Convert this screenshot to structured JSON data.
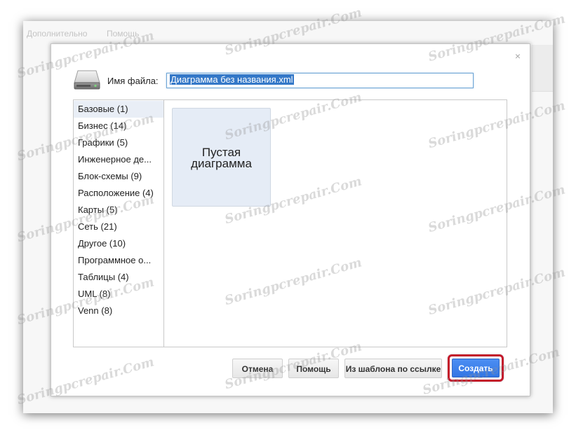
{
  "app": {
    "menu": [
      "Дополнительно",
      "Помощь"
    ]
  },
  "dialog": {
    "close_glyph": "×",
    "filename_label": "Имя файла:",
    "filename_value": "Диаграмма без названия.xml",
    "categories": [
      {
        "label": "Базовые (1)",
        "active": true
      },
      {
        "label": "Бизнес (14)"
      },
      {
        "label": "Графики (5)"
      },
      {
        "label": "Инженерное де..."
      },
      {
        "label": "Блок-схемы (9)"
      },
      {
        "label": "Расположение (4)"
      },
      {
        "label": "Карты (5)"
      },
      {
        "label": "Сеть (21)"
      },
      {
        "label": "Другое (10)"
      },
      {
        "label": "Программное о..."
      },
      {
        "label": "Таблицы (4)"
      },
      {
        "label": "UML (8)"
      },
      {
        "label": "Venn (8)"
      }
    ],
    "template_card": {
      "line1": "Пустая",
      "line2": "диаграмма"
    },
    "buttons": {
      "cancel": "Отмена",
      "help": "Помощь",
      "from_template_url": "Из шаблона по ссылке",
      "create": "Создать"
    }
  },
  "watermark_text": "Soringpcrepair.Com",
  "colors": {
    "primary_button": "#3d83ee",
    "highlight_ring": "#c4172a",
    "selected_text_bg": "#3478c8",
    "template_card_bg": "#e5ecf6"
  },
  "icons": {
    "file_icon": "hard-drive-icon",
    "close_icon": "close-icon"
  }
}
